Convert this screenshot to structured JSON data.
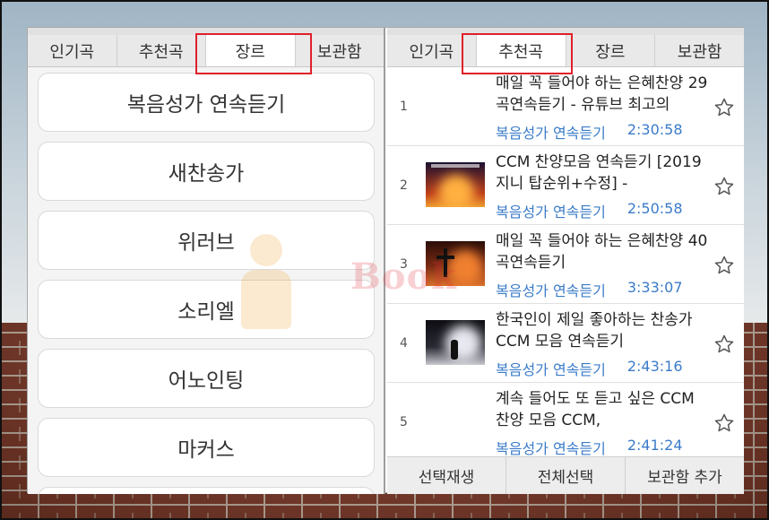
{
  "tabs": [
    "인기곡",
    "추천곡",
    "장르",
    "보관함"
  ],
  "left_panel": {
    "active_tab": "장르",
    "genres": [
      "복음성가 연속듣기",
      "새찬송가",
      "위러브",
      "소리엘",
      "어노인팅",
      "마커스"
    ]
  },
  "right_panel": {
    "active_tab": "추천곡",
    "songs": [
      {
        "num": "1",
        "title": "매일 꼭 들어야 하는 은혜찬양 29곡연속듣기 - 유튜브 최고의",
        "category": "복음성가 연속듣기",
        "duration": "2:30:58",
        "has_thumb": false
      },
      {
        "num": "2",
        "title": "CCM 찬양모음 연속듣기 [2019 지니 탑순위+수정] -",
        "category": "복음성가 연속듣기",
        "duration": "2:50:58",
        "has_thumb": true
      },
      {
        "num": "3",
        "title": "매일 꼭 들어야 하는 은혜찬양 40곡연속듣기",
        "category": "복음성가 연속듣기",
        "duration": "3:33:07",
        "has_thumb": true
      },
      {
        "num": "4",
        "title": "한국인이 제일 좋아하는 찬송가 CCM 모음 연속듣기",
        "category": "복음성가 연속듣기",
        "duration": "2:43:16",
        "has_thumb": true
      },
      {
        "num": "5",
        "title": "계속 들어도 또 듣고 싶은 CCM 찬양 모음 CCM,",
        "category": "복음성가 연속듣기",
        "duration": "2:41:24",
        "has_thumb": false
      }
    ],
    "actions": [
      "선택재생",
      "전체선택",
      "보관함 추가"
    ]
  },
  "watermark": "Book",
  "colors": {
    "highlight": "#e0202a",
    "link": "#3a7bc8",
    "tab_bg": "#e9e9e9"
  },
  "icons": {
    "favorite": "star-outline-icon"
  }
}
